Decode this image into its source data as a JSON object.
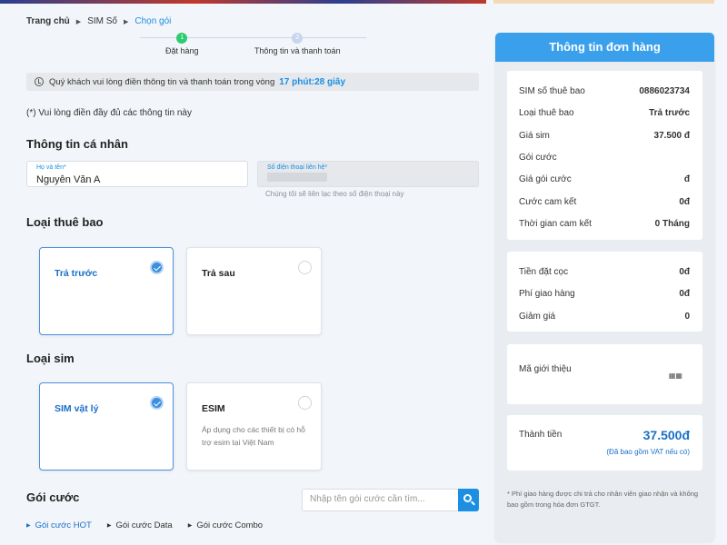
{
  "breadcrumb": {
    "items": [
      "Trang chủ",
      "SIM Số",
      "Chọn gói"
    ]
  },
  "stepper": {
    "steps": [
      {
        "number": "1",
        "label": "Đặt hàng"
      },
      {
        "number": "2",
        "label": "Thông tin và thanh toán"
      }
    ]
  },
  "notice": {
    "text": "Quý khách vui lòng điền thông tin và thanh toán trong vòng",
    "timer": "17 phút:28 giây"
  },
  "required_note": "(*) Vui lòng điền đầy đủ các thông tin này",
  "personal": {
    "title": "Thông tin cá nhân",
    "name_label": "Họ và tên*",
    "name_value": "Nguyễn Văn A",
    "phone_label": "Số điện thoại liên hệ*",
    "phone_hint": "Chúng tôi sẽ liên lạc theo số điện thoại này"
  },
  "subscription": {
    "title": "Loại thuê bao",
    "options": [
      {
        "label": "Trả trước",
        "selected": true
      },
      {
        "label": "Trả sau",
        "selected": false
      }
    ]
  },
  "sim_type": {
    "title": "Loại sim",
    "options": [
      {
        "label": "SIM vật lý",
        "selected": true,
        "desc": ""
      },
      {
        "label": "ESIM",
        "selected": false,
        "desc": "Áp dụng cho các thiết bị có hỗ trợ esim tại Việt Nam"
      }
    ]
  },
  "plans": {
    "title": "Gói cước",
    "search_placeholder": "Nhập tên gói cước cần tìm...",
    "tabs": [
      {
        "label": "Gói cước HOT",
        "active": true
      },
      {
        "label": "Gói cước Data",
        "active": false
      },
      {
        "label": "Gói cước Combo",
        "active": false
      }
    ]
  },
  "order": {
    "title": "Thông tin đơn hàng",
    "rows": [
      {
        "label": "SIM số thuê bao",
        "value": "0886023734"
      },
      {
        "label": "Loại thuê bao",
        "value": "Trả trước"
      },
      {
        "label": "Giá sim",
        "value": "37.500 đ"
      },
      {
        "label": "Gói cước",
        "value": ""
      },
      {
        "label": "Giá gói cước",
        "value": "đ"
      },
      {
        "label": "Cước cam kết",
        "value": "0đ"
      },
      {
        "label": "Thời gian cam kết",
        "value": "0 Tháng"
      }
    ],
    "fees": [
      {
        "label": "Tiền đặt cọc",
        "value": "0đ"
      },
      {
        "label": "Phí giao hàng",
        "value": "0đ"
      },
      {
        "label": "Giảm giá",
        "value": "0"
      }
    ],
    "referral_label": "Mã giới thiệu",
    "total_label": "Thành tiền",
    "total_value": "37.500đ",
    "vat_note": "(Đã bao gồm VAT nếu có)",
    "footnote": "* Phí giao hàng được chi trả cho nhân viên giao nhận và không bao gồm trong hóa đơn GTGT."
  },
  "colors": {
    "accent": "#1a8fe3",
    "header": "#3aa0ec",
    "step_done": "#2ecc71"
  }
}
